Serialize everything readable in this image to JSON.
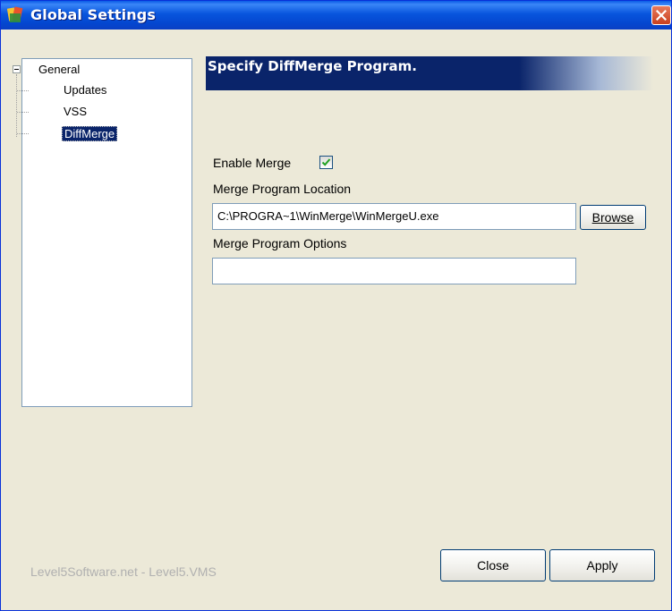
{
  "window": {
    "title": "Global Settings"
  },
  "tree": {
    "root": "General",
    "children": [
      "Updates",
      "VSS",
      "DiffMerge"
    ],
    "selected": "DiffMerge"
  },
  "panel": {
    "header": "Specify DiffMerge Program.",
    "enable_merge_label": "Enable Merge",
    "enable_merge_checked": true,
    "location_label": "Merge Program Location",
    "location_value": "C:\\PROGRA~1\\WinMerge\\WinMergeU.exe",
    "browse_button": "Browse",
    "options_label": "Merge Program Options",
    "options_value": ""
  },
  "footer": {
    "brand": "Level5Software.net - Level5.VMS",
    "close_button": "Close",
    "apply_button": "Apply"
  },
  "colors": {
    "titlebar": "#0a5ae6",
    "header_banner": "#0a246a",
    "dialog_bg": "#ece9d8",
    "selection": "#0a246a",
    "checkmark": "#21a121"
  }
}
